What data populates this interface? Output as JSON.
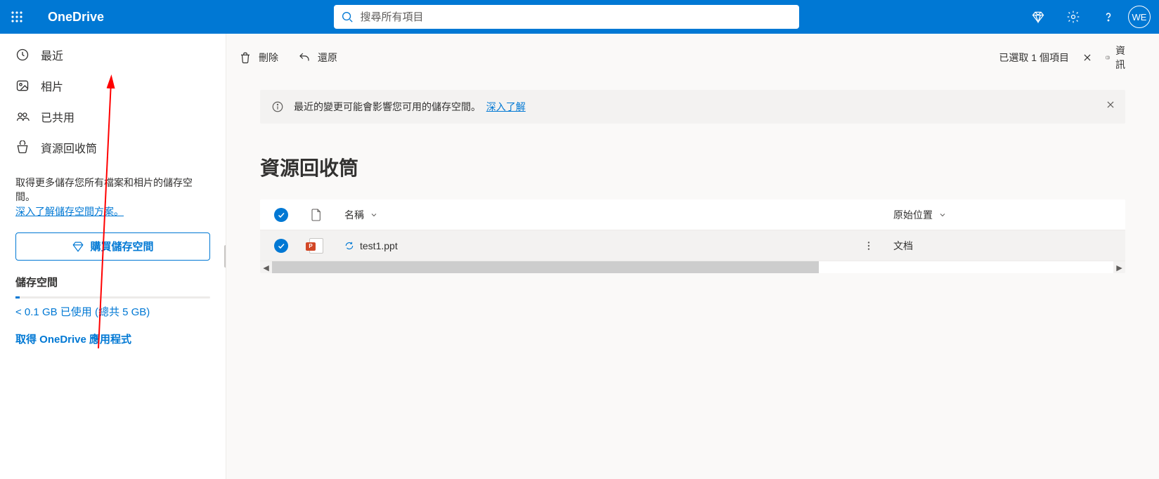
{
  "header": {
    "brand": "OneDrive",
    "search_placeholder": "搜尋所有項目",
    "avatar_initials": "WE"
  },
  "sidebar": {
    "items": [
      {
        "id": "recent",
        "label": "最近"
      },
      {
        "id": "photos",
        "label": "相片"
      },
      {
        "id": "shared",
        "label": "已共用"
      },
      {
        "id": "recycle",
        "label": "資源回收筒"
      }
    ],
    "storage_promo_text": "取得更多儲存您所有檔案和相片的儲存空間。",
    "storage_promo_link": "深入了解儲存空間方案。",
    "buy_label": "購買儲存空間",
    "storage_heading": "儲存空間",
    "storage_used": "< 0.1 GB 已使用 (總共 5 GB)",
    "get_app": "取得 OneDrive 應用程式"
  },
  "toolbar": {
    "delete_label": "刪除",
    "restore_label": "還原",
    "selected_text": "已選取 1 個項目",
    "info_label": "資訊"
  },
  "banner": {
    "text": "最近的變更可能會影響您可用的儲存空間。",
    "link": "深入了解"
  },
  "page": {
    "title": "資源回收筒"
  },
  "table": {
    "col_name": "名稱",
    "col_origin": "原始位置",
    "rows": [
      {
        "filename": "test1.ppt",
        "origin": "文档"
      }
    ]
  }
}
